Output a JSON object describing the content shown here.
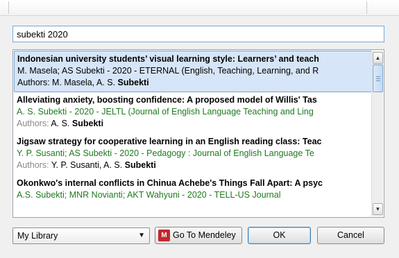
{
  "search": {
    "value": "subekti 2020"
  },
  "results": [
    {
      "title": "Indonesian university students’ visual learning style: Learners’ and teach",
      "meta": "M. Masela; AS Subekti - 2020 - ETERNAL (English, Teaching, Learning, and R",
      "meta_style": "black",
      "authors_label": "Authors: ",
      "authors_name": "M. Masela, A. S. ",
      "authors_bold": "Subekti"
    },
    {
      "title": "Alleviating anxiety, boosting confidence: A proposed model of Willis' Tas",
      "meta": "A. S. Subekti - 2020 - JELTL (Journal of English Language Teaching and Ling",
      "meta_style": "green",
      "authors_label": "Authors: ",
      "authors_name": "A. S. ",
      "authors_bold": "Subekti"
    },
    {
      "title": "Jigsaw strategy for cooperative learning in an English reading class: Teac",
      "meta": "Y. P. Susanti; AS Subekti - 2020 - Pedagogy : Journal of English Language Te",
      "meta_style": "green",
      "authors_label": "Authors: ",
      "authors_name": "Y. P. Susanti, A. S. ",
      "authors_bold": "Subekti"
    },
    {
      "title": "Okonkwo's internal conflicts in Chinua Achebe's Things Fall Apart: A psyc",
      "meta": "A.S. Subekti; MNR Novianti; AKT Wahyuni - 2020 - TELL-US Journal",
      "meta_style": "green",
      "authors_label": "",
      "authors_name": "",
      "authors_bold": ""
    }
  ],
  "library_select": {
    "selected": "My Library"
  },
  "buttons": {
    "mendeley": "Go To Mendeley",
    "ok": "OK",
    "cancel": "Cancel"
  },
  "icons": {
    "mendeley": "mendeley-logo-icon",
    "dropdown": "chevron-down-icon",
    "scroll_up": "arrow-up-icon",
    "scroll_down": "arrow-down-icon"
  },
  "colors": {
    "selection": "#d6e5f7",
    "green_meta": "#1f7a1f",
    "mendeley_red": "#c0282d"
  }
}
